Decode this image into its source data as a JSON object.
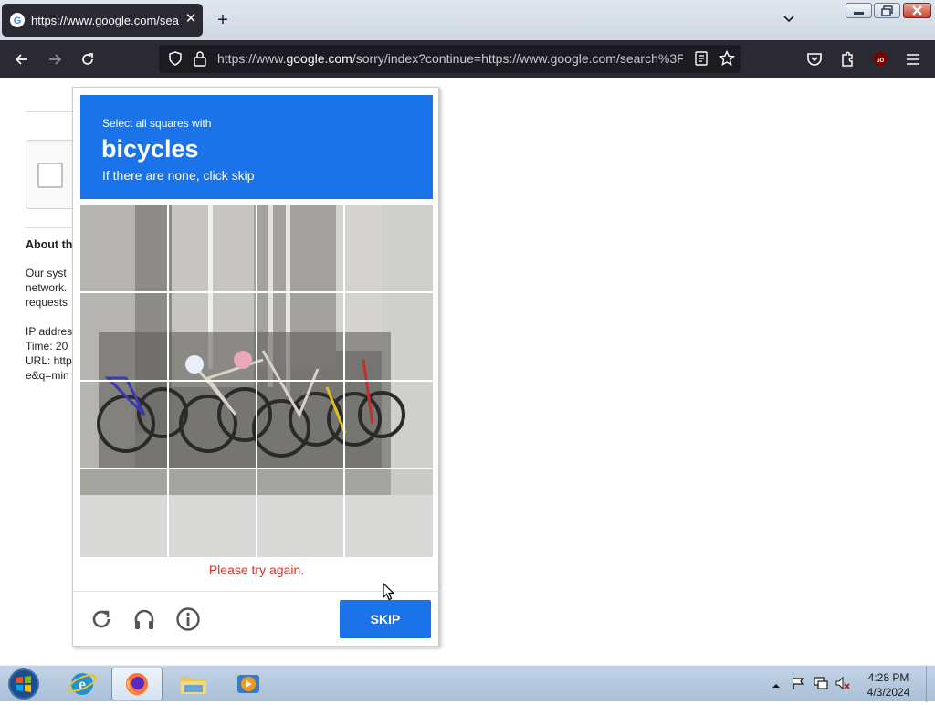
{
  "browser": {
    "tab_title": "https://www.google.com/search",
    "url_prefix": "https://www.",
    "url_domain": "google.com",
    "url_rest": "/sorry/index?continue=https://www.google.com/search%3F",
    "icons": [
      "back-icon",
      "forward-icon",
      "reload-icon",
      "shield-icon",
      "lock-icon",
      "reader-icon",
      "bookmark-star-icon",
      "pocket-icon",
      "extensions-icon",
      "ublock-icon",
      "menu-icon"
    ]
  },
  "page": {
    "about_heading": "About th",
    "about_lines": [
      "Our syst",
      "network.",
      "requests"
    ],
    "info_lines": [
      "IP addres",
      "Time: 20",
      "URL: http",
      "e&q=min"
    ]
  },
  "captcha": {
    "instruction": "Select all squares with",
    "target": "bicycles",
    "subtext": "If there are none, click skip",
    "error": "Please try again.",
    "skip_label": "SKIP",
    "header_color": "#1a73e8",
    "error_color": "#d93025"
  },
  "taskbar": {
    "time": "4:28 PM",
    "date": "4/3/2024",
    "apps": [
      "windows-start-icon",
      "internet-explorer-icon",
      "firefox-icon",
      "file-explorer-icon",
      "media-player-icon"
    ]
  }
}
